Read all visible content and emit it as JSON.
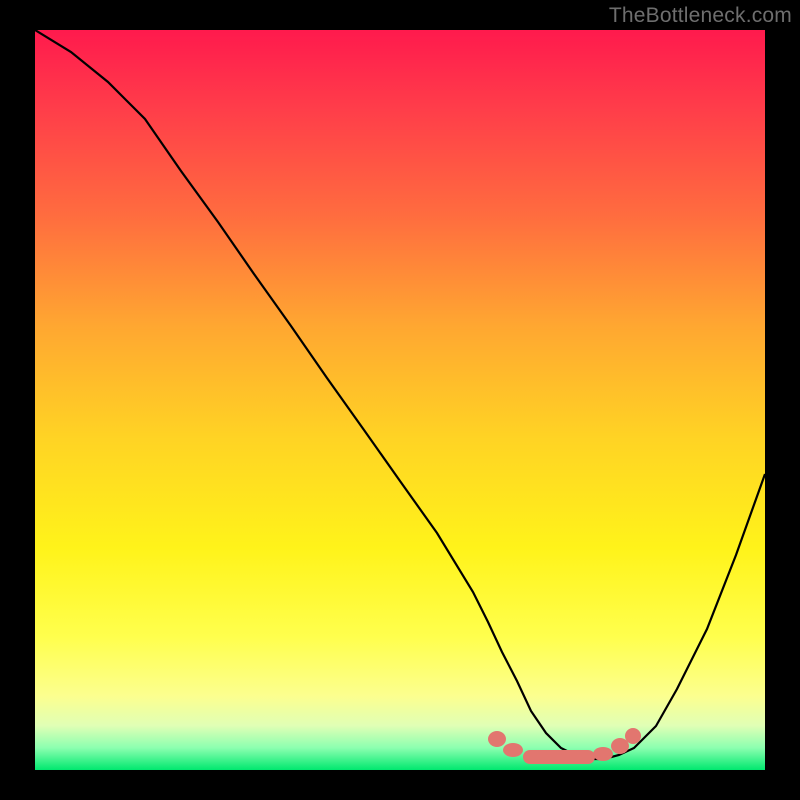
{
  "watermark": "TheBottleneck.com",
  "chart_data": {
    "type": "line",
    "title": "",
    "xlabel": "",
    "ylabel": "",
    "xlim": [
      0,
      100
    ],
    "ylim": [
      0,
      100
    ],
    "background": "red-yellow-green vertical gradient (red top, green bottom)",
    "series": [
      {
        "name": "bottleneck-curve",
        "color": "#000000",
        "x": [
          0,
          5,
          10,
          15,
          20,
          25,
          30,
          35,
          40,
          45,
          50,
          55,
          60,
          62,
          64,
          66,
          68,
          70,
          72,
          74,
          76,
          78,
          80,
          82,
          85,
          88,
          92,
          96,
          100
        ],
        "y_pct": [
          0,
          3,
          7,
          12,
          19,
          26,
          33,
          40,
          47,
          54,
          61,
          68,
          76,
          80,
          84,
          88,
          92,
          95,
          97,
          98,
          98.5,
          98.5,
          98,
          97,
          94,
          89,
          81,
          71,
          60
        ]
      }
    ],
    "markers": {
      "name": "optimal-range",
      "color": "#e2766f",
      "shape": "rounded-blob",
      "x_range": [
        63,
        80
      ],
      "y_pct_approx": 97
    },
    "note": "y_pct is measured as percentage from TOP of plot area (0 = top, 100 = bottom). Values estimated from pixels; axes have no tick labels."
  }
}
